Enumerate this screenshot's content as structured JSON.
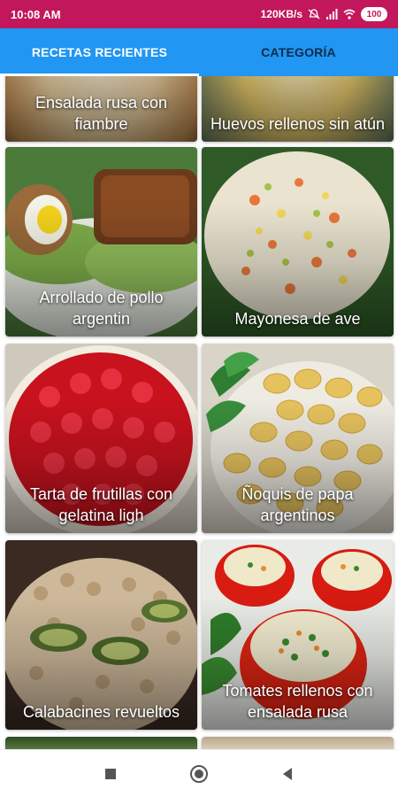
{
  "status_bar": {
    "time": "10:08 AM",
    "net_speed": "120KB/s",
    "battery": "100",
    "bg_color": "#c2185b",
    "icons": [
      "bell-off-icon",
      "signal-icon",
      "wifi-icon",
      "battery-icon"
    ]
  },
  "tabs": [
    {
      "label": "RECETAS RECIENTES",
      "active": true
    },
    {
      "label": "CATEGORÍA",
      "active": false
    }
  ],
  "accent_color": "#2196f3",
  "recipes": [
    {
      "title": "Ensalada rusa con fiambre"
    },
    {
      "title": "Huevos rellenos sin atún"
    },
    {
      "title": "Arrollado de pollo argentin"
    },
    {
      "title": "Mayonesa de ave"
    },
    {
      "title": "Tarta de frutillas con gelatina ligh"
    },
    {
      "title": "Ñoquis de papa argentinos"
    },
    {
      "title": "Calabacines revueltos"
    },
    {
      "title": "Tomates rellenos con ensalada rusa"
    }
  ],
  "nav_bar": {
    "icons": [
      "recents-square-icon",
      "home-circle-icon",
      "back-triangle-icon"
    ]
  }
}
